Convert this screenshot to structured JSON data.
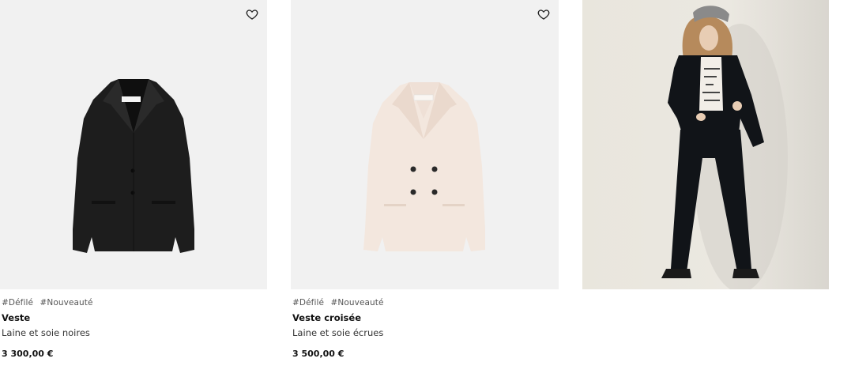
{
  "products": [
    {
      "tags": [
        "#Défilé",
        "#Nouveauté"
      ],
      "name": "Veste",
      "description": "Laine et soie noires",
      "price": "3 300,00 €",
      "color": "#1f1f1f"
    },
    {
      "tags": [
        "#Défilé",
        "#Nouveauté"
      ],
      "name": "Veste croisée",
      "description": "Laine et soie écrues",
      "price": "3 500,00 €",
      "color": "#f3e6dc"
    }
  ],
  "editorial": {
    "image_subject": "model-wearing-velvet-suit"
  },
  "icons": {
    "favorite": "heart-icon"
  }
}
